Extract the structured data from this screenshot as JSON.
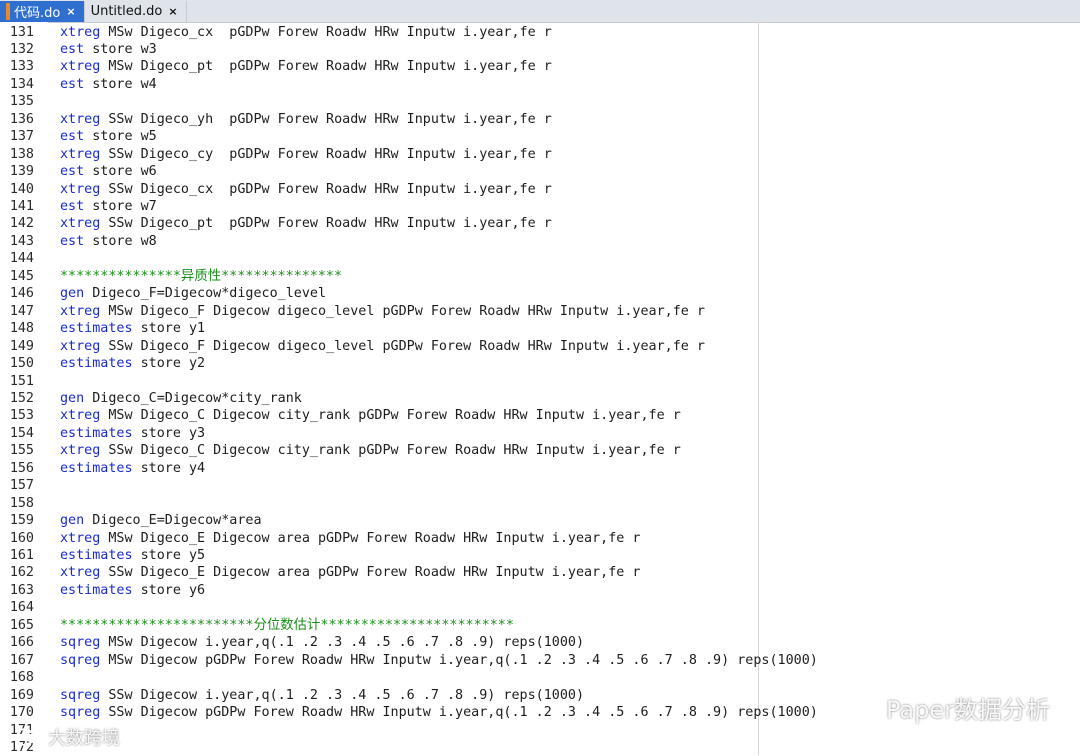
{
  "tabs": [
    {
      "label": "代码.do",
      "active": true,
      "close": "×"
    },
    {
      "label": "Untitled.do",
      "active": false,
      "close": "×"
    }
  ],
  "lines": [
    {
      "n": "131",
      "kw": "xtreg",
      "rest": " MSw Digeco_cx  pGDPw Forew Roadw HRw Inputw i.year,fe r"
    },
    {
      "n": "132",
      "kw": "est",
      "rest": " store w3"
    },
    {
      "n": "133",
      "kw": "xtreg",
      "rest": " MSw Digeco_pt  pGDPw Forew Roadw HRw Inputw i.year,fe r"
    },
    {
      "n": "134",
      "kw": "est",
      "rest": " store w4"
    },
    {
      "n": "135",
      "kw": "",
      "rest": ""
    },
    {
      "n": "136",
      "kw": "xtreg",
      "rest": " SSw Digeco_yh  pGDPw Forew Roadw HRw Inputw i.year,fe r"
    },
    {
      "n": "137",
      "kw": "est",
      "rest": " store w5"
    },
    {
      "n": "138",
      "kw": "xtreg",
      "rest": " SSw Digeco_cy  pGDPw Forew Roadw HRw Inputw i.year,fe r"
    },
    {
      "n": "139",
      "kw": "est",
      "rest": " store w6"
    },
    {
      "n": "140",
      "kw": "xtreg",
      "rest": " SSw Digeco_cx  pGDPw Forew Roadw HRw Inputw i.year,fe r"
    },
    {
      "n": "141",
      "kw": "est",
      "rest": " store w7"
    },
    {
      "n": "142",
      "kw": "xtreg",
      "rest": " SSw Digeco_pt  pGDPw Forew Roadw HRw Inputw i.year,fe r"
    },
    {
      "n": "143",
      "kw": "est",
      "rest": " store w8"
    },
    {
      "n": "144",
      "kw": "",
      "rest": ""
    },
    {
      "n": "145",
      "comment": "***************异质性***************"
    },
    {
      "n": "146",
      "kw": "gen",
      "rest": " Digeco_F=Digecow*digeco_level"
    },
    {
      "n": "147",
      "kw": "xtreg",
      "rest": " MSw Digeco_F Digecow digeco_level pGDPw Forew Roadw HRw Inputw i.year,fe r"
    },
    {
      "n": "148",
      "kw": "estimates",
      "rest": " store y1"
    },
    {
      "n": "149",
      "kw": "xtreg",
      "rest": " SSw Digeco_F Digecow digeco_level pGDPw Forew Roadw HRw Inputw i.year,fe r"
    },
    {
      "n": "150",
      "kw": "estimates",
      "rest": " store y2"
    },
    {
      "n": "151",
      "kw": "",
      "rest": ""
    },
    {
      "n": "152",
      "kw": "gen",
      "rest": " Digeco_C=Digecow*city_rank"
    },
    {
      "n": "153",
      "kw": "xtreg",
      "rest": " MSw Digeco_C Digecow city_rank pGDPw Forew Roadw HRw Inputw i.year,fe r"
    },
    {
      "n": "154",
      "kw": "estimates",
      "rest": " store y3"
    },
    {
      "n": "155",
      "kw": "xtreg",
      "rest": " SSw Digeco_C Digecow city_rank pGDPw Forew Roadw HRw Inputw i.year,fe r"
    },
    {
      "n": "156",
      "kw": "estimates",
      "rest": " store y4"
    },
    {
      "n": "157",
      "kw": "",
      "rest": ""
    },
    {
      "n": "158",
      "kw": "",
      "rest": ""
    },
    {
      "n": "159",
      "kw": "gen",
      "rest": " Digeco_E=Digecow*area"
    },
    {
      "n": "160",
      "kw": "xtreg",
      "rest": " MSw Digeco_E Digecow area pGDPw Forew Roadw HRw Inputw i.year,fe r"
    },
    {
      "n": "161",
      "kw": "estimates",
      "rest": " store y5"
    },
    {
      "n": "162",
      "kw": "xtreg",
      "rest": " SSw Digeco_E Digecow area pGDPw Forew Roadw HRw Inputw i.year,fe r"
    },
    {
      "n": "163",
      "kw": "estimates",
      "rest": " store y6"
    },
    {
      "n": "164",
      "kw": "",
      "rest": ""
    },
    {
      "n": "165",
      "comment": "************************分位数估计************************"
    },
    {
      "n": "166",
      "kw": "sqreg",
      "rest": " MSw Digecow i.year,q(.1 .2 .3 .4 .5 .6 .7 .8 .9) reps(1000)"
    },
    {
      "n": "167",
      "kw": "sqreg",
      "rest": " MSw Digecow pGDPw Forew Roadw HRw Inputw i.year,q(.1 .2 .3 .4 .5 .6 .7 .8 .9) reps(1000)"
    },
    {
      "n": "168",
      "kw": "",
      "rest": ""
    },
    {
      "n": "169",
      "kw": "sqreg",
      "rest": " SSw Digecow i.year,q(.1 .2 .3 .4 .5 .6 .7 .8 .9) reps(1000)"
    },
    {
      "n": "170",
      "kw": "sqreg",
      "rest": " SSw Digecow pGDPw Forew Roadw HRw Inputw i.year,q(.1 .2 .3 .4 .5 .6 .7 .8 .9) reps(1000)"
    },
    {
      "n": "171",
      "kw": "",
      "rest": ""
    },
    {
      "n": "172",
      "kw": "",
      "rest": ""
    }
  ],
  "watermarks": {
    "right": "Paper数据分析",
    "left": "大数跨境"
  },
  "colors": {
    "keyword": "#1a2bd0",
    "comment": "#1b8f1b",
    "active_tab": "#2f6fd0"
  }
}
